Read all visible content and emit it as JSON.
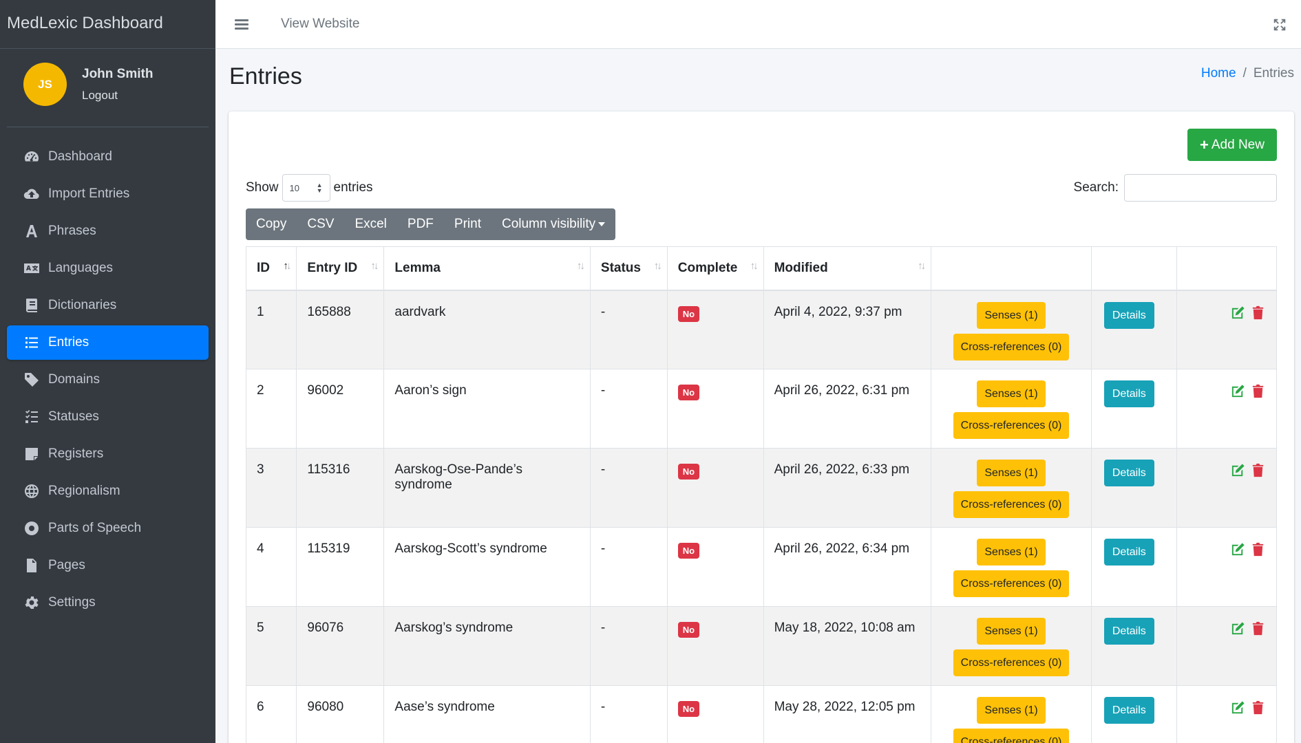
{
  "brand": "MedLexic Dashboard",
  "user": {
    "initials": "JS",
    "name": "John Smith",
    "logout": "Logout"
  },
  "nav": [
    {
      "label": "Dashboard",
      "icon": "tachometer-icon"
    },
    {
      "label": "Import Entries",
      "icon": "cloud-upload-icon"
    },
    {
      "label": "Phrases",
      "icon": "font-icon"
    },
    {
      "label": "Languages",
      "icon": "language-icon"
    },
    {
      "label": "Dictionaries",
      "icon": "book-icon"
    },
    {
      "label": "Entries",
      "icon": "list-icon",
      "active": true
    },
    {
      "label": "Domains",
      "icon": "tag-icon"
    },
    {
      "label": "Statuses",
      "icon": "tasks-icon"
    },
    {
      "label": "Registers",
      "icon": "sticky-note-icon"
    },
    {
      "label": "Regionalism",
      "icon": "globe-icon"
    },
    {
      "label": "Parts of Speech",
      "icon": "dot-circle-icon"
    },
    {
      "label": "Pages",
      "icon": "file-icon"
    },
    {
      "label": "Settings",
      "icon": "gear-icon"
    }
  ],
  "topbar": {
    "view_website": "View Website"
  },
  "header": {
    "title": "Entries",
    "breadcrumb_home": "Home",
    "breadcrumb_current": "Entries",
    "breadcrumb_sep": "/"
  },
  "toolbar": {
    "add_new": "Add New",
    "show": "Show",
    "entries_suffix": "entries",
    "page_length": "10",
    "search_label": "Search:",
    "search_value": "",
    "export_buttons": [
      "Copy",
      "CSV",
      "Excel",
      "PDF",
      "Print"
    ],
    "column_visibility": "Column visibility"
  },
  "table": {
    "columns": [
      "ID",
      "Entry ID",
      "Lemma",
      "Status",
      "Complete",
      "Modified"
    ],
    "rows": [
      {
        "id": "1",
        "entry_id": "165888",
        "lemma": "aardvark",
        "status": "-",
        "complete": "No",
        "modified": "April 4, 2022, 9:37 pm",
        "senses": "Senses (1)",
        "xrefs": "Cross-references (0)",
        "details": "Details"
      },
      {
        "id": "2",
        "entry_id": "96002",
        "lemma": "Aaron’s sign",
        "status": "-",
        "complete": "No",
        "modified": "April 26, 2022, 6:31 pm",
        "senses": "Senses (1)",
        "xrefs": "Cross-references (0)",
        "details": "Details"
      },
      {
        "id": "3",
        "entry_id": "115316",
        "lemma": "Aarskog-Ose-Pande’s syndrome",
        "status": "-",
        "complete": "No",
        "modified": "April 26, 2022, 6:33 pm",
        "senses": "Senses (1)",
        "xrefs": "Cross-references (0)",
        "details": "Details"
      },
      {
        "id": "4",
        "entry_id": "115319",
        "lemma": "Aarskog-Scott’s syndrome",
        "status": "-",
        "complete": "No",
        "modified": "April 26, 2022, 6:34 pm",
        "senses": "Senses (1)",
        "xrefs": "Cross-references (0)",
        "details": "Details"
      },
      {
        "id": "5",
        "entry_id": "96076",
        "lemma": "Aarskog’s syndrome",
        "status": "-",
        "complete": "No",
        "modified": "May 18, 2022, 10:08 am",
        "senses": "Senses (1)",
        "xrefs": "Cross-references (0)",
        "details": "Details"
      },
      {
        "id": "6",
        "entry_id": "96080",
        "lemma": "Aase’s syndrome",
        "status": "-",
        "complete": "No",
        "modified": "May 28, 2022, 12:05 pm",
        "senses": "Senses (1)",
        "xrefs": "Cross-references (0)",
        "details": "Details"
      }
    ]
  },
  "colors": {
    "sidebar": "#343a40",
    "primary": "#007bff",
    "success": "#28a745",
    "warning": "#ffc107",
    "info": "#17a2b8",
    "danger": "#dc3545"
  }
}
